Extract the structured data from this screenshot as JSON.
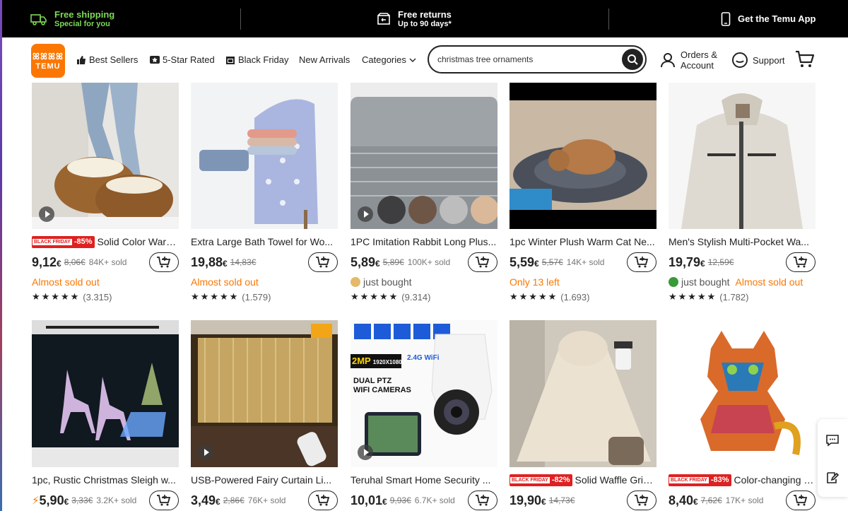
{
  "promo": {
    "shipping_title": "Free shipping",
    "shipping_sub": "Special for you",
    "returns_title": "Free returns",
    "returns_sub": "Up to 90 days*",
    "app_label": "Get the Temu App"
  },
  "header": {
    "logo_top": "ꕤꕤꕤꕤ",
    "logo_text": "TEMU",
    "nav": {
      "best_sellers": "Best Sellers",
      "five_star": "5-Star Rated",
      "black_friday": "Black Friday",
      "new_arrivals": "New Arrivals",
      "categories": "Categories"
    },
    "search_value": "christmas tree ornaments",
    "orders_line1": "Orders &",
    "orders_line2": "Account",
    "support": "Support"
  },
  "badge": {
    "bf": "BLACK FRIDAY"
  },
  "products": [
    {
      "title": "Solid Color Warm ...",
      "badge_pct": "-85%",
      "price": "9,12",
      "currency": "€",
      "old": "8,06€",
      "sold": "84K+ sold",
      "status": "Almost sold out",
      "rating": "(3.315)"
    },
    {
      "title": "Extra Large Bath Towel for Wo...",
      "price": "19,88",
      "currency": "€",
      "old": "14,83€",
      "sold": "",
      "status": "Almost sold out",
      "rating": "(1.579)"
    },
    {
      "title": "1PC Imitation Rabbit Long Plus...",
      "price": "5,89",
      "currency": "€",
      "old": "5,89€",
      "sold": "100K+ sold",
      "status": "just bought",
      "rating": "(9.314)"
    },
    {
      "title": "1pc Winter Plush Warm Cat Ne...",
      "price": "5,59",
      "currency": "€",
      "old": "5,57€",
      "sold": "14K+ sold",
      "status": "Only 13 left",
      "rating": "(1.693)"
    },
    {
      "title": "Men's Stylish Multi-Pocket Wa...",
      "price": "19,79",
      "currency": "€",
      "old": "12,59€",
      "sold": "",
      "status": "just bought",
      "status2": "Almost sold out",
      "rating": "(1.782)"
    },
    {
      "title": "1pc, Rustic Christmas Sleigh w...",
      "price": "5,90",
      "currency": "€",
      "old": "3,33€",
      "sold": "3.2K+ sold"
    },
    {
      "title": "USB-Powered Fairy Curtain Li...",
      "price": "3,49",
      "currency": "€",
      "old": "2,86€",
      "sold": "76K+ sold"
    },
    {
      "title": "Teruhal Smart Home Security ...",
      "price": "10,01",
      "currency": "€",
      "old": "9,93€",
      "sold": "6.7K+ sold",
      "overlay_2mp": "2MP",
      "overlay_res": "1920X1080P",
      "overlay_wifi": "2.4G WiFi",
      "overlay_dual": "DUAL PTZ",
      "overlay_cams": "WIFI CAMERAS"
    },
    {
      "title": "Solid Waffle Grid F...",
      "badge_pct": "-82%",
      "price": "19,90",
      "currency": "€",
      "old": "14,73€",
      "sold": ""
    },
    {
      "title": "Color-changing C...",
      "badge_pct": "-83%",
      "price": "8,40",
      "currency": "€",
      "old": "7,62€",
      "sold": "17K+ sold"
    }
  ],
  "stars": "★★★★★",
  "colors": {
    "accent": "#fb7701",
    "promo_green": "#7ed957",
    "badge_red": "#e02020"
  }
}
